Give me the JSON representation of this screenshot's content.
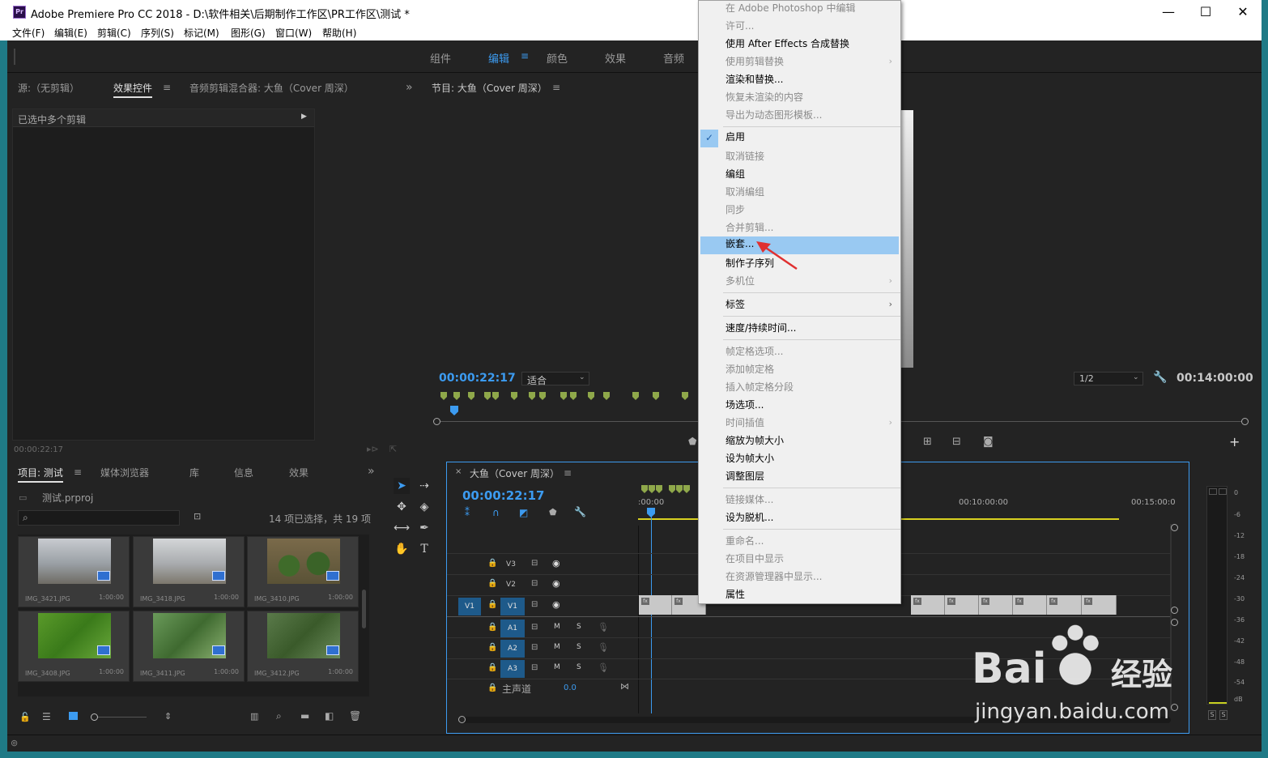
{
  "window": {
    "title": "Adobe Premiere Pro CC 2018 - D:\\软件相关\\后期制作工作区\\PR工作区\\测试 *",
    "app_icon_text": "Pr",
    "minimize": "—",
    "maximize": "☐",
    "close": "✕"
  },
  "menubar": [
    "文件(F)",
    "编辑(E)",
    "剪辑(C)",
    "序列(S)",
    "标记(M)",
    "图形(G)",
    "窗口(W)",
    "帮助(H)"
  ],
  "workspaces": [
    {
      "label": "组件",
      "active": false
    },
    {
      "label": "编辑",
      "active": true
    },
    {
      "label": "颜色",
      "active": false
    },
    {
      "label": "效果",
      "active": false
    },
    {
      "label": "音频",
      "active": false
    }
  ],
  "source_panel": {
    "tabs": [
      "源:（无剪辑）",
      "效果控件",
      "音频剪辑混合器: 大鱼（Cover 周深）"
    ],
    "selected_label": "已选中多个剪辑",
    "timecode": "00:00:22:17"
  },
  "program_panel": {
    "title": "节目: 大鱼（Cover 周深）",
    "timecode": "00:00:22:17",
    "fit": "适合",
    "resolution": "1/2",
    "duration": "00:14:00:00"
  },
  "project_panel": {
    "tabs": [
      "项目: 测试",
      "媒体浏览器",
      "库",
      "信息",
      "效果"
    ],
    "file": "测试.prproj",
    "selection_status": "14 项已选择，共 19 项",
    "thumbs": [
      {
        "name": "IMG_3421.JPG",
        "duration": "1:00:00",
        "color": "#8a8f94"
      },
      {
        "name": "IMG_3418.JPG",
        "duration": "1:00:00",
        "color": "#9aa0a6"
      },
      {
        "name": "IMG_3410.JPG",
        "duration": "1:00:00",
        "color": "#5a7a3a"
      },
      {
        "name": "IMG_3408.JPG",
        "duration": "1:00:00",
        "color": "#4a8a2a"
      },
      {
        "name": "IMG_3411.JPG",
        "duration": "1:00:00",
        "color": "#5a8a4a"
      },
      {
        "name": "IMG_3412.JPG",
        "duration": "1:00:00",
        "color": "#4a6a3a"
      }
    ]
  },
  "timeline": {
    "title": "大鱼（Cover 周深）",
    "timecode": "00:00:22:17",
    "ruler": [
      ":00:00",
      "00:10:00:00",
      "00:15:00:0"
    ],
    "tracks_video": [
      "V3",
      "V2",
      "V1"
    ],
    "tracks_audio": [
      "A1",
      "A2",
      "A3"
    ],
    "source_patch": "V1",
    "master_label": "主声道",
    "master_value": "0.0",
    "m": "M",
    "s": "S"
  },
  "meter": {
    "labels": [
      "0",
      "-6",
      "-12",
      "-18",
      "-24",
      "-30",
      "-36",
      "-42",
      "-48",
      "-54",
      "dB"
    ],
    "solo": [
      "S",
      "S"
    ]
  },
  "context_menu": {
    "items": [
      {
        "label": "在 Adobe Photoshop 中编辑",
        "disabled": true
      },
      {
        "label": "许可...",
        "disabled": true
      },
      {
        "label": "使用 After Effects 合成替换",
        "disabled": false
      },
      {
        "label": "使用剪辑替换",
        "disabled": true,
        "submenu": true
      },
      {
        "label": "渲染和替换...",
        "disabled": false
      },
      {
        "label": "恢复未渲染的内容",
        "disabled": true
      },
      {
        "label": "导出为动态图形模板...",
        "disabled": true
      },
      {
        "label": "启用",
        "disabled": false,
        "checked": true
      },
      {
        "label": "取消链接",
        "disabled": true
      },
      {
        "label": "编组",
        "disabled": false
      },
      {
        "label": "取消编组",
        "disabled": true
      },
      {
        "label": "同步",
        "disabled": true
      },
      {
        "label": "合并剪辑...",
        "disabled": true
      },
      {
        "label": "嵌套...",
        "disabled": false,
        "highlight": true
      },
      {
        "label": "制作子序列",
        "disabled": false
      },
      {
        "label": "多机位",
        "disabled": true,
        "submenu": true
      },
      {
        "label": "标签",
        "disabled": false,
        "submenu": true
      },
      {
        "label": "速度/持续时间...",
        "disabled": false
      },
      {
        "label": "帧定格选项...",
        "disabled": true
      },
      {
        "label": "添加帧定格",
        "disabled": true
      },
      {
        "label": "插入帧定格分段",
        "disabled": true
      },
      {
        "label": "场选项...",
        "disabled": false
      },
      {
        "label": "时间插值",
        "disabled": true,
        "submenu": true
      },
      {
        "label": "缩放为帧大小",
        "disabled": false
      },
      {
        "label": "设为帧大小",
        "disabled": false
      },
      {
        "label": "调整图层",
        "disabled": false
      },
      {
        "label": "链接媒体...",
        "disabled": true
      },
      {
        "label": "设为脱机...",
        "disabled": false
      },
      {
        "label": "重命名...",
        "disabled": true
      },
      {
        "label": "在项目中显示",
        "disabled": true
      },
      {
        "label": "在资源管理器中显示...",
        "disabled": true
      },
      {
        "label": "属性",
        "disabled": false
      }
    ],
    "checkmark": "✓",
    "submenu_arrow": "›"
  },
  "watermark": {
    "brand": "Bai",
    "brand2": "经验",
    "url": "jingyan.baidu.com"
  },
  "icons": {
    "search": "search-icon",
    "wrench": "wrench-icon",
    "camera": "camera-icon"
  }
}
